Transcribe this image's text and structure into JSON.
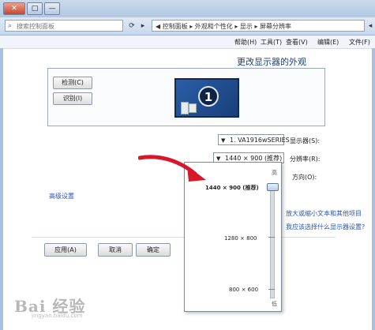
{
  "window": {
    "close_label": "✕",
    "maximize_label": "□",
    "minimize_label": "—"
  },
  "address_bar": {
    "search_placeholder": "搜索控制面板",
    "breadcrumb": "◀ 控制面板 ▸ 外观和个性化 ▸ 显示 ▸ 屏幕分辨率",
    "forward_label": "▸",
    "back_label": "◂"
  },
  "menu": {
    "items": [
      "文件(F)",
      "编辑(E)",
      "查看(V)",
      "工具(T)",
      "帮助(H)"
    ]
  },
  "page": {
    "title": "更改显示器的外观",
    "detect_label": "检测(C)",
    "identify_label": "识别(I)",
    "monitor_number": "1"
  },
  "form": {
    "display_label": "显示器(S):",
    "display_value": "1. VA1916wSERIES",
    "resolution_label": "分辨率(R):",
    "resolution_value": "1440 × 900 (推荐)",
    "orientation_label": "方向(O):",
    "advanced_link": "高级设置",
    "text_size_link": "放大或缩小文本和其他项目",
    "display_settings_link": "我应该选择什么显示器设置?"
  },
  "resolution_popup": {
    "high_label": "高",
    "low_label": "低",
    "options": [
      {
        "label": "1440 × 900 (推荐)",
        "selected": true
      },
      {
        "label": "1280 × 800",
        "selected": false
      },
      {
        "label": "800 × 600",
        "selected": false
      }
    ],
    "slider_level": 1.0
  },
  "footer": {
    "ok_label": "确定",
    "cancel_label": "取消",
    "apply_label": "应用(A)"
  },
  "watermark": {
    "brand": "Bai 经验",
    "url": "jingyan.baidu.com"
  },
  "colors": {
    "title_blue": "#1e3f7a",
    "link_blue": "#2a56b0",
    "arrow_red": "#d8182a"
  }
}
